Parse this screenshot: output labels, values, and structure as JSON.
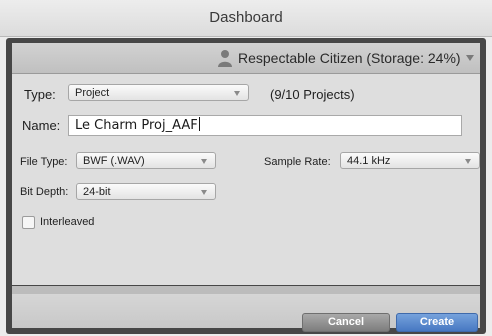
{
  "window": {
    "title": "Dashboard"
  },
  "user": {
    "label": "Respectable Citizen (Storage: 24%)"
  },
  "form": {
    "type_label": "Type:",
    "type_value": "Project",
    "projects_count": "(9/10 Projects)",
    "name_label": "Name:",
    "name_value": "Le Charm Proj_AAF",
    "file_type_label": "File Type:",
    "file_type_value": "BWF (.WAV)",
    "sample_rate_label": "Sample Rate:",
    "sample_rate_value": "44.1 kHz",
    "bit_depth_label": "Bit Depth:",
    "bit_depth_value": "24-bit",
    "interleaved_label": "Interleaved"
  },
  "buttons": {
    "cancel": "Cancel",
    "create": "Create"
  },
  "colors": {
    "accent": "#4f80c9",
    "frame": "#474747"
  }
}
